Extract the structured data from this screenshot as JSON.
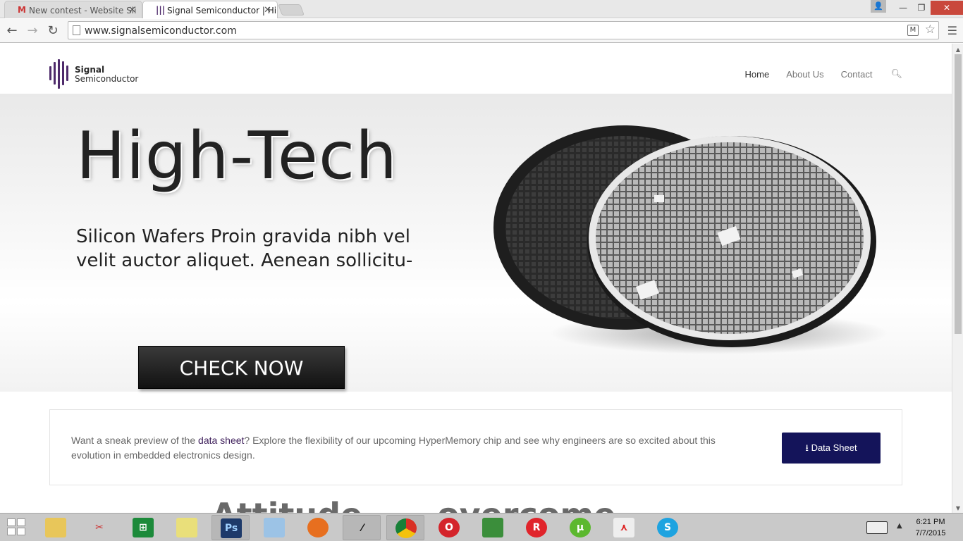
{
  "browser": {
    "tabs": [
      {
        "title": "New contest - Website Sli",
        "favicon": "gmail-icon"
      },
      {
        "title": "Signal Semiconductor | Hi",
        "favicon": "signal-logo-icon"
      }
    ],
    "url": "www.signalsemiconductor.com"
  },
  "site": {
    "logo": {
      "line1": "Signal",
      "line2": "Semiconductor"
    },
    "nav": [
      "Home",
      "About Us",
      "Contact"
    ],
    "hero": {
      "title": "High-Tech",
      "subtitle": "Silicon Wafers Proin gravida nibh vel velit auctor aliquet. Aenean sollicitu-",
      "cta": "CHECK NOW"
    },
    "promo": {
      "text_before": "Want a sneak preview of the ",
      "link": "data sheet",
      "text_after": "?  Explore the flexibility of our upcoming HyperMemory chip and see why engineers are so excited about this evolution in embedded electronics design.",
      "button": "Data Sheet"
    },
    "ghost": {
      "left": "Attitude",
      "right": "overcome"
    }
  },
  "taskbar": {
    "time": "6:21 PM",
    "date": "7/7/2015",
    "apps": [
      "file-explorer-icon",
      "snipping-tool-icon",
      "store-icon",
      "sticky-notes-icon",
      "photoshop-icon",
      "notepad-icon",
      "firefox-icon",
      "color-picker-icon",
      "chrome-icon",
      "opera-icon",
      "sheets-icon",
      "r-app-icon",
      "utorrent-icon",
      "acrobat-icon",
      "skype-icon"
    ]
  },
  "colors": {
    "brand_purple": "#4e2a6b",
    "button_navy": "#14145a",
    "hero_button": "#1f1f1f"
  }
}
